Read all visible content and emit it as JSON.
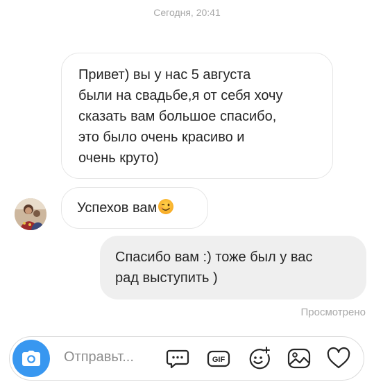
{
  "header": {
    "timestamp": "Сегодня, 20:41"
  },
  "messages": [
    {
      "direction": "incoming",
      "lines": [
        "Привет) вы у нас 5 августа",
        "были на свадьбе,я от себя хочу",
        "сказать вам большое спасибо,",
        "это было очень красиво и",
        "очень круто)"
      ]
    },
    {
      "direction": "incoming",
      "text": "Успехов вам",
      "emoji": "winking-face"
    },
    {
      "direction": "outgoing",
      "lines": [
        "Спасибо вам :) тоже был у вас",
        "рад выступить )"
      ]
    }
  ],
  "status": {
    "seen": "Просмотрено"
  },
  "composer": {
    "placeholder": "Отправьт...",
    "icons": [
      "camera-icon",
      "chat-bubble-icon",
      "gif-icon",
      "sticker-icon",
      "gallery-icon",
      "heart-icon"
    ]
  },
  "colors": {
    "accent": "#3897f0",
    "outgoing_bubble": "#efefef",
    "muted_text": "#a8a8a8"
  }
}
